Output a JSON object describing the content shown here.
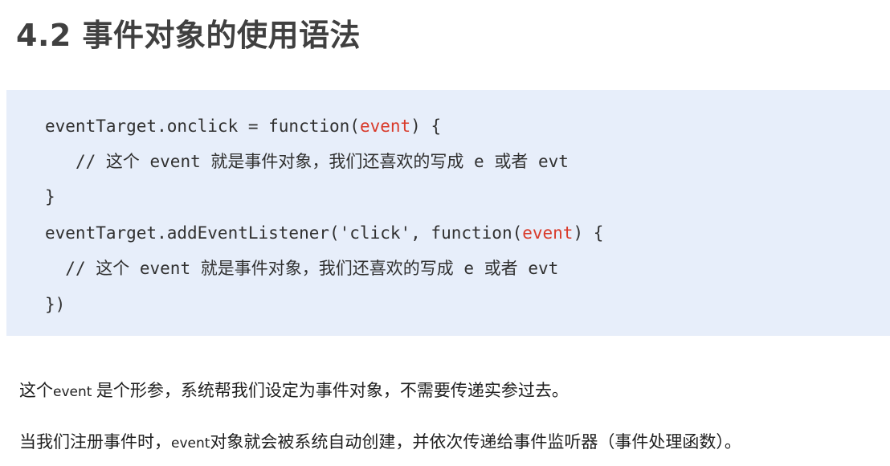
{
  "title": "4.2 事件对象的使用语法",
  "code": {
    "line1": {
      "before": "eventTarget.onclick = function(",
      "param": "event",
      "after": ") {"
    },
    "line2": {
      "indent": "   ",
      "comment_prefix": "// ",
      "cjk1": "这个",
      "mid": " event ",
      "cjk2": "就是事件对象，我们还喜欢的写成",
      "mid2": " e ",
      "cjk3": "或者",
      "tail": " evt"
    },
    "line3": "}",
    "line4": {
      "before": "eventTarget.addEventListener('click', function(",
      "param": "event",
      "after": ") {"
    },
    "line5": {
      "indent": "  ",
      "comment_prefix": "// ",
      "cjk1": "这个",
      "mid": " event ",
      "cjk2": "就是事件对象，我们还喜欢的写成",
      "mid2": " e ",
      "cjk3": "或者",
      "tail": " evt"
    },
    "line6": "})"
  },
  "paragraph1": {
    "prefix": "这个",
    "keyword": "event ",
    "rest": "是个形参，系统帮我们设定为事件对象，不需要传递实参过去。"
  },
  "paragraph2": {
    "prefix": "当我们注册事件时，",
    "keyword": "event",
    "rest": "对象就会被系统自动创建，并依次传递给事件监听器（事件处理函数）。"
  }
}
